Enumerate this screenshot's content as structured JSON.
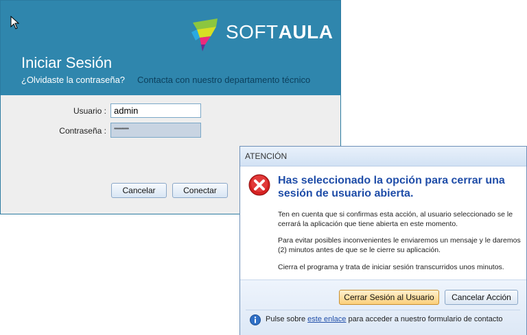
{
  "login": {
    "brand_prefix": "SOFT",
    "brand_suffix": "AULA",
    "title": "Iniciar Sesión",
    "forgot_password": "¿Olvidaste la contraseña?",
    "contact": "Contacta con nuestro departamento técnico",
    "user_label": "Usuario :",
    "user_value": "admin",
    "password_label": "Contraseña :",
    "password_mask": "**********",
    "cancel_label": "Cancelar",
    "connect_label": "Conectar"
  },
  "dialog": {
    "title": "ATENCIÓN",
    "heading": "Has seleccionado la opción para cerrar una sesión de usuario abierta.",
    "paragraphs": [
      "Ten en cuenta que si confirmas esta acción, al usuario seleccionado se le cerrará la aplicación que tiene abierta en este momento.",
      "Para evitar posibles inconvenientes le enviaremos un mensaje y le daremos (2) minutos antes de que se le cierre su aplicación.",
      "Cierra el programa y trata de iniciar sesión transcurridos unos minutos."
    ],
    "confirm_label": "Cerrar Sesión al Usuario",
    "cancel_label": "Cancelar Acción",
    "footer_prefix": "Pulse sobre ",
    "footer_link": "este enlace",
    "footer_suffix": " para acceder a nuestro formulario de contacto"
  },
  "icons": {
    "cursor": "mouse-pointer-icon",
    "logo": "softaula-logo",
    "error": "error-icon",
    "info": "info-icon"
  },
  "colors": {
    "header_blue": "#2f86ad",
    "heading_blue": "#1f4da8",
    "error_red": "#d42121",
    "primary_button_orange": "#fbcf7a"
  }
}
